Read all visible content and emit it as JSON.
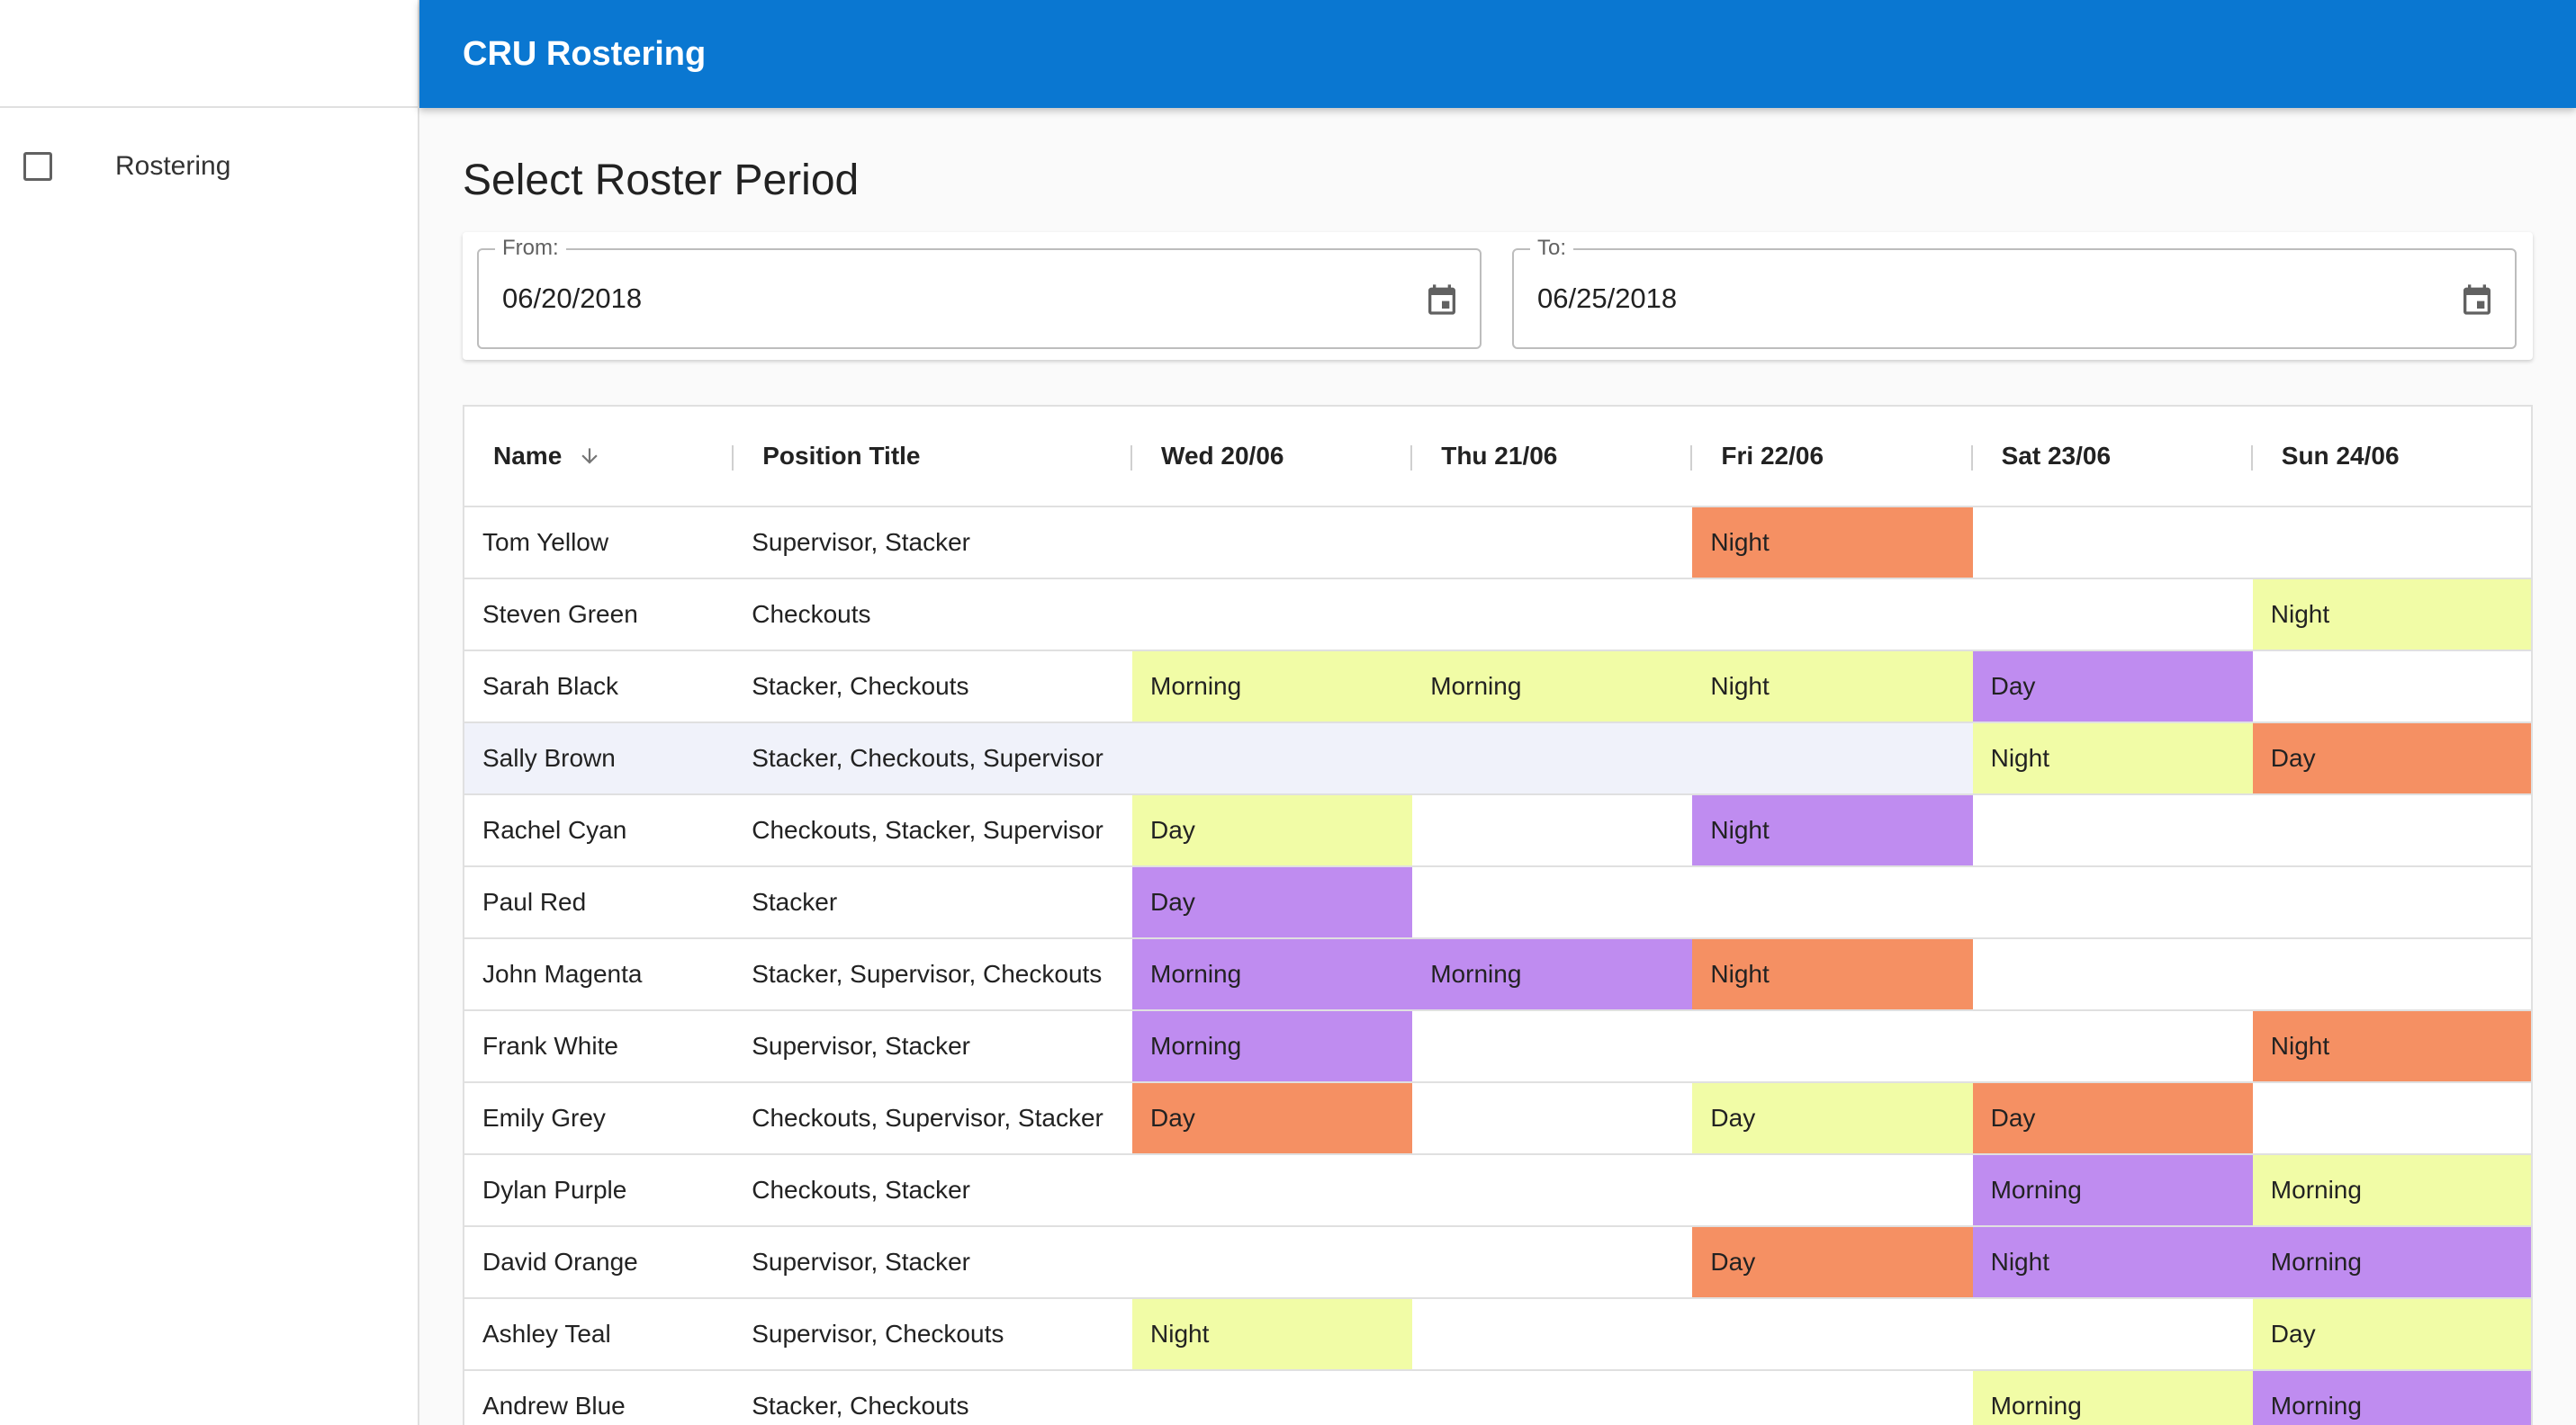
{
  "app": {
    "title": "CRU Rostering"
  },
  "sidebar": {
    "items": [
      {
        "label": "Rostering"
      }
    ]
  },
  "period": {
    "title": "Select Roster Period",
    "from_label": "From:",
    "from_value": "06/20/2018",
    "to_label": "To:",
    "to_value": "06/25/2018"
  },
  "colors": {
    "yellow": "#f1fca6",
    "orange": "#f59063",
    "purple": "#bf8cf0",
    "appbar": "#0a77d1"
  },
  "table": {
    "columns": [
      "Name",
      "Position Title",
      "Wed 20/06",
      "Thu 21/06",
      "Fri 22/06",
      "Sat 23/06",
      "Sun 24/06"
    ],
    "rows": [
      {
        "name": "Tom Yellow",
        "position": "Supervisor, Stacker",
        "shifts": [
          null,
          null,
          {
            "label": "Night",
            "color": "orange"
          },
          null,
          null
        ]
      },
      {
        "name": "Steven Green",
        "position": "Checkouts",
        "shifts": [
          null,
          null,
          null,
          null,
          {
            "label": "Night",
            "color": "yellow"
          }
        ]
      },
      {
        "name": "Sarah Black",
        "position": "Stacker, Checkouts",
        "shifts": [
          {
            "label": "Morning",
            "color": "yellow"
          },
          {
            "label": "Morning",
            "color": "yellow"
          },
          {
            "label": "Night",
            "color": "yellow"
          },
          {
            "label": "Day",
            "color": "purple"
          },
          null
        ]
      },
      {
        "name": "Sally Brown",
        "position": "Stacker, Checkouts, Supervisor",
        "hover": true,
        "shifts": [
          null,
          null,
          null,
          {
            "label": "Night",
            "color": "yellow"
          },
          {
            "label": "Day",
            "color": "orange"
          }
        ]
      },
      {
        "name": "Rachel Cyan",
        "position": "Checkouts, Stacker, Supervisor",
        "shifts": [
          {
            "label": "Day",
            "color": "yellow"
          },
          null,
          {
            "label": "Night",
            "color": "purple"
          },
          null,
          null
        ]
      },
      {
        "name": "Paul Red",
        "position": "Stacker",
        "shifts": [
          {
            "label": "Day",
            "color": "purple"
          },
          null,
          null,
          null,
          null
        ]
      },
      {
        "name": "John Magenta",
        "position": "Stacker, Supervisor, Checkouts",
        "shifts": [
          {
            "label": "Morning",
            "color": "purple"
          },
          {
            "label": "Morning",
            "color": "purple"
          },
          {
            "label": "Night",
            "color": "orange"
          },
          null,
          null
        ]
      },
      {
        "name": "Frank White",
        "position": "Supervisor, Stacker",
        "shifts": [
          {
            "label": "Morning",
            "color": "purple"
          },
          null,
          null,
          null,
          {
            "label": "Night",
            "color": "orange"
          }
        ]
      },
      {
        "name": "Emily Grey",
        "position": "Checkouts, Supervisor, Stacker",
        "shifts": [
          {
            "label": "Day",
            "color": "orange"
          },
          null,
          {
            "label": "Day",
            "color": "yellow"
          },
          {
            "label": "Day",
            "color": "orange"
          },
          null
        ]
      },
      {
        "name": "Dylan Purple",
        "position": "Checkouts, Stacker",
        "shifts": [
          null,
          null,
          null,
          {
            "label": "Morning",
            "color": "purple"
          },
          {
            "label": "Morning",
            "color": "yellow"
          }
        ]
      },
      {
        "name": "David Orange",
        "position": "Supervisor, Stacker",
        "shifts": [
          null,
          null,
          {
            "label": "Day",
            "color": "orange"
          },
          {
            "label": "Night",
            "color": "purple"
          },
          {
            "label": "Morning",
            "color": "purple"
          }
        ]
      },
      {
        "name": "Ashley Teal",
        "position": "Supervisor, Checkouts",
        "shifts": [
          {
            "label": "Night",
            "color": "yellow"
          },
          null,
          null,
          null,
          {
            "label": "Day",
            "color": "yellow"
          }
        ]
      },
      {
        "name": "Andrew Blue",
        "position": "Stacker, Checkouts",
        "shifts": [
          null,
          null,
          null,
          {
            "label": "Morning",
            "color": "yellow"
          },
          {
            "label": "Morning",
            "color": "purple"
          }
        ]
      }
    ]
  }
}
